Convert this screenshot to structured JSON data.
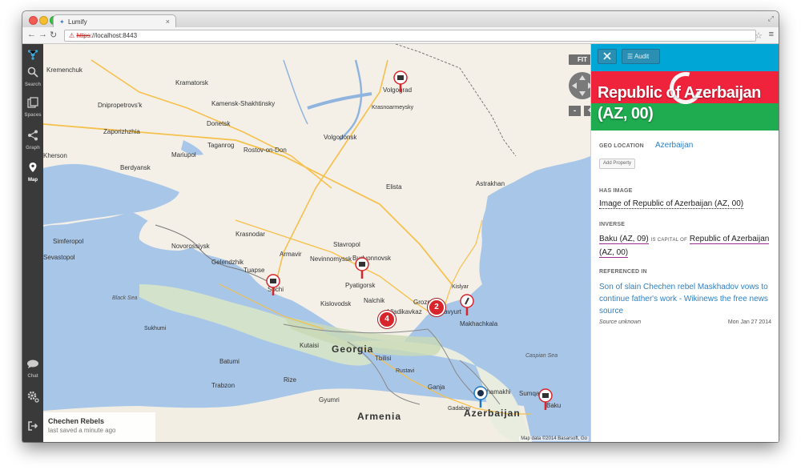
{
  "browser": {
    "tab_title": "Lumify",
    "url_scheme": "https",
    "url_host": "://localhost:8443"
  },
  "sidebar": {
    "items": [
      {
        "label": "Search",
        "icon": "search-icon"
      },
      {
        "label": "Spaces",
        "icon": "spaces-icon"
      },
      {
        "label": "Graph",
        "icon": "graph-icon"
      },
      {
        "label": "Map",
        "icon": "map-pin-icon"
      },
      {
        "label": "Chat",
        "icon": "chat-icon"
      },
      {
        "label": "",
        "icon": "gear-icon"
      },
      {
        "label": "",
        "icon": "logout-icon"
      }
    ]
  },
  "map": {
    "fit_label": "FIT",
    "zoom_out": "-",
    "zoom_in": "+",
    "attribution": "Map data ©2014 Basarsoft, Go",
    "clusters": [
      "4",
      "2"
    ],
    "cities": [
      "Kremenchuk",
      "Kramatorsk",
      "Kamensk-Shakhtinsky",
      "Dnipropetrovs'k",
      "Donetsk",
      "Zaporizhzhia",
      "Taganrog",
      "Rostov-on-Don",
      "Volgodonsk",
      "Volgograd",
      "Krasnoarmeysky",
      "Mariupol",
      "Kherson",
      "Elista",
      "Astrakhan",
      "Berdyansk",
      "Krasnodar",
      "Stavropol",
      "Simferopol",
      "Sevastopol",
      "Novorossiysk",
      "Gelendzhik",
      "Tuapse",
      "Sochi",
      "Armavir",
      "Nevinnomyssk",
      "Budyonnovsk",
      "Pyatigorsk",
      "Nalchik",
      "Kislovodsk",
      "Vladikavkaz",
      "Grozny",
      "Khasavyurt",
      "Makhachkala",
      "Batumi",
      "Kutaisi",
      "Tbilisi",
      "Trabzon",
      "Rize",
      "Gyumri",
      "Ganja",
      "Shamakhi",
      "Sumqayit",
      "Baku",
      "Gadabay",
      "Rustavi",
      "Sukhumi",
      "Kislyar"
    ],
    "countries": [
      "Georgia",
      "Armenia",
      "Azerbaijan"
    ],
    "seas": [
      "Black Sea",
      "Caspian Sea"
    ]
  },
  "workspace": {
    "title": "Chechen Rebels",
    "status": "last saved a minute ago"
  },
  "panel": {
    "close_icon": "close-icon",
    "audit_label": "Audit",
    "title": "Republic of Azerbaijan (AZ, 00)",
    "sections": {
      "geo_location": {
        "label": "GEO LOCATION",
        "value": "Azerbaijan"
      },
      "add_property": "Add Property",
      "has_image": {
        "label": "HAS IMAGE",
        "value": "Image of Republic of Azerbaijan (AZ, 00)"
      },
      "inverse": {
        "label": "INVERSE",
        "source": "Baku (AZ, 09)",
        "relation": "IS CAPITAL OF",
        "target": "Republic of Azerbaijan (AZ, 00)"
      },
      "referenced_in": {
        "label": "REFERENCED IN",
        "title": "Son of slain Chechen rebel Maskhadov vows to continue father's work - Wikinews the free news source",
        "source": "Source unknown",
        "date": "Mon Jan 27 2014"
      }
    }
  },
  "colors": {
    "sidebar": "#3a3a3a",
    "panel_header": "#00a6d6",
    "flag_red": "#ef233c",
    "flag_green": "#1fab4f",
    "link": "#2e80c4",
    "cluster": "#d8242b"
  }
}
